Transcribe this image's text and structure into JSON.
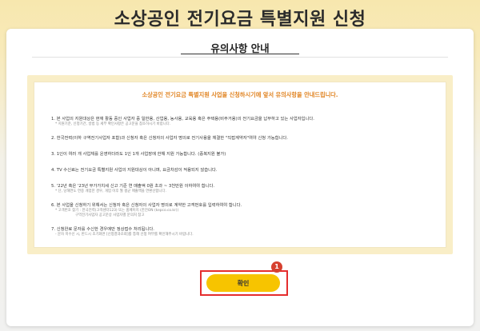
{
  "page": {
    "title": "소상공인 전기요금 특별지원 신청"
  },
  "section": {
    "title": "유의사항 안내"
  },
  "notice": {
    "heading": "소상공인 전기요금 특별지원 사업을 신청하시기에 앞서 유의사항을 안내드립니다.",
    "items": [
      {
        "text": "1. 본 사업의 지원대상은 현재 활동 중인 사업자 중 일반용, 산업용, 농사용, 교육용 혹은 주택용(비주거용)의 전기요금을 납부하고 있는 사업자입니다.",
        "sub": "* 지원기준, 신청기간, 방법 등 세부 확인사항은 공고문을 참조하시기 바랍니다."
      },
      {
        "text": "2. 한국전력(이하 구역전기사업자 포함)과 신청자 혹은 신청자의 사업자 명의로 전기사용을 체결한 \"직접계약자\"여야 신청 가능합니다."
      },
      {
        "text": "3. 1인이 여러 개 사업체를 운영하더라도 1인 1개 사업장에 한해 지원 가능합니다. (중복지원 불가)"
      },
      {
        "text": "4. TV 수신료는 전기요금 특별지원 사업의 지원대상이 아니며, 요금차감이 적용되지 않습니다."
      },
      {
        "text": "5. '22년 혹은 '23년 부가가치세 신고 기준 연 매출액 0원 초과 ~ 3천만원 이하여야 합니다.",
        "sub": "* 단, 당해연도 연중 개업한 경우, 개업 이후 월 평균 매출액을 연환산합니다."
      },
      {
        "text": "6. 본 사업을 신청하기 위해서는 신청자 혹은 신청자의 사업자 명의로 계약한 고객번호를 입력하여야 합니다.",
        "sub": "* 고객번호 찾기 : 한국전력(고객센터123) 또는 홈페이지 (한전ON (kepco.co.kr))",
        "sub2": "구역전기사업자 공고문상 사업자별 문의처 참고"
      },
      {
        "text": "7. 신청완료 문자를 수신한 경우에만 정상접수 처리됩니다.",
        "sub": "- 문자 미수신 시, 반드시 초기화면 [신청결과조회]를 통해 신청 여부를 확인해주시기 바랍니다."
      }
    ]
  },
  "actions": {
    "confirm_label": "확인",
    "step_number": "1"
  },
  "colors": {
    "accent": "#f7c400",
    "heading_orange": "#e0821f",
    "highlight_red": "#e52d2d",
    "badge_red": "#d6402f"
  }
}
